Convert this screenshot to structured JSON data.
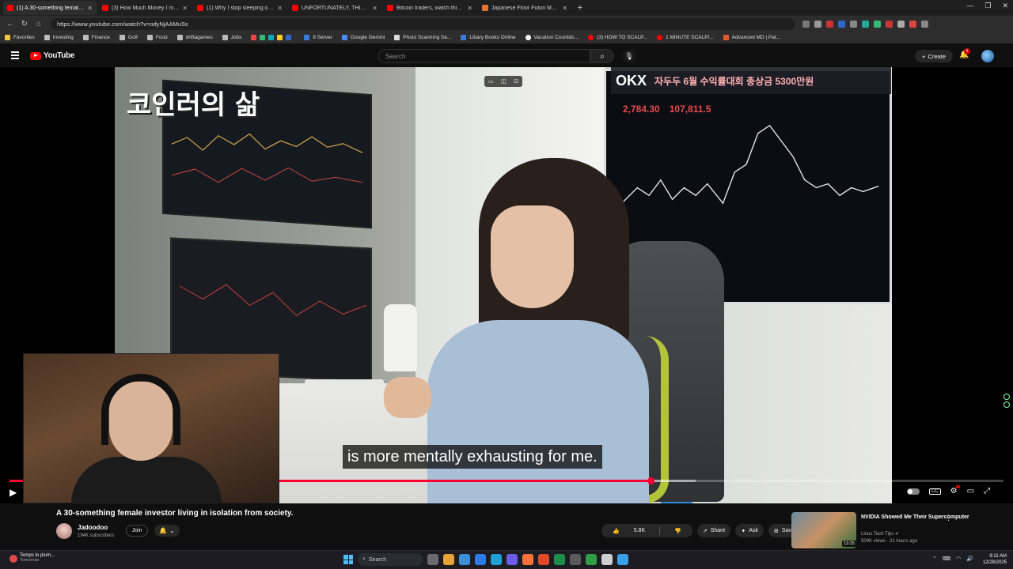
{
  "browser": {
    "tabs": [
      {
        "title": "(1) A 30-something female in...",
        "active": true
      },
      {
        "title": "(3) How Much Money I made Day..."
      },
      {
        "title": "(1) Why I stop sleeping on beds a..."
      },
      {
        "title": "UNFORTUNATELY, THIS IS WHERE..."
      },
      {
        "title": "Bitcoin traders, watch this before..."
      },
      {
        "title": "Japanese Floor Futon Mattress – J..."
      }
    ],
    "url": "https://www.youtube.com/watch?v=odyNjAAMuSs",
    "bookmarks": [
      {
        "label": "Favorites",
        "color": "#f5c542"
      },
      {
        "label": "Investing",
        "color": "#bbbbbb"
      },
      {
        "label": "Finance",
        "color": "#bbbbbb"
      },
      {
        "label": "Golf",
        "color": "#bbbbbb"
      },
      {
        "label": "Food",
        "color": "#bbbbbb"
      },
      {
        "label": "driftagames",
        "color": "#bbbbbb"
      },
      {
        "label": "Jobs",
        "color": "#bbbbbb"
      },
      {
        "label": "8 Server",
        "color": "#3a7bd5"
      },
      {
        "label": "Google Gemini",
        "color": "#4a8cff"
      },
      {
        "label": "Photo Scanning Se...",
        "color": "#dddddd"
      },
      {
        "label": "Libary Books Online",
        "color": "#3a7bd5"
      },
      {
        "label": "Vacation Countdo...",
        "color": "#ffffff"
      },
      {
        "label": "(3) HOW TO SCALP...",
        "color": "#ff0000"
      },
      {
        "label": "1 MINUTE SCALPI...",
        "color": "#ff0000"
      },
      {
        "label": "Advanced MD | Pat...",
        "color": "#e25a2b"
      }
    ]
  },
  "youtube": {
    "logo_text": "YouTube",
    "search_placeholder": "Search",
    "create_label": "Create",
    "notification_count": "9"
  },
  "video": {
    "overlay_title": "코인러의 삶",
    "banner_logo": "OKX",
    "banner_text": "자두두 6월 수익률대회 총상금 5300만원",
    "prices": [
      "2,784.30",
      "107,811.5"
    ],
    "subtitle": "is more mentally exhausting for me.",
    "progress_played": 0.645,
    "progress_buffered_end": 0.69
  },
  "meta": {
    "title": "A 30-something female investor living in isolation from society.",
    "channel": "Jadoodoo",
    "subscribers": "194K subscribers",
    "join_label": "Join",
    "likes": "5.8K",
    "share_label": "Share",
    "ask_label": "Ask",
    "save_label": "Save"
  },
  "recommendation": {
    "title": "NVIDIA Showed Me Their Supercomputer",
    "channel": "Linus Tech Tips",
    "meta": "509K views · 21 hours ago",
    "duration": "13:25"
  },
  "taskbar": {
    "weather_title": "Temps to plum...",
    "weather_sub": "Tomorrow",
    "search_label": "Search",
    "time": "9:11 AM",
    "date": "12/28/2025"
  },
  "colors": {
    "accent": "#ff0033",
    "youtube_red": "#ff0000",
    "background": "#0f0f0f"
  }
}
